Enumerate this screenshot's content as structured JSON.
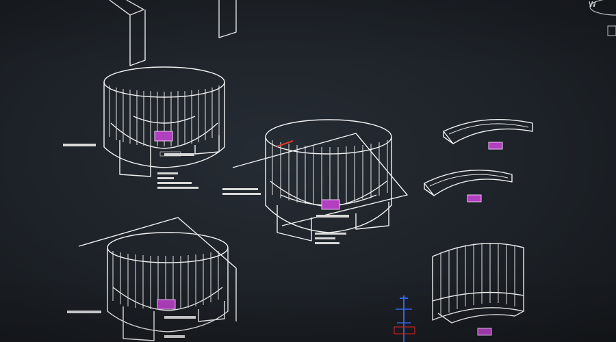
{
  "viewport": {
    "background": "#1d2228",
    "wire_color": "#f2f2f2",
    "marker_color": "#b23fc0",
    "axis_z_color": "#3b6cff",
    "axis_x_color": "#e02626"
  },
  "view_cube": {
    "compass_letter": "W"
  },
  "ucs_icon": {
    "name": "ucs-icon"
  },
  "annotations": {
    "note_1": "",
    "note_2": "",
    "note_3": "",
    "note_4": "",
    "note_5": "",
    "note_6": "",
    "note_7": "",
    "note_8": ""
  }
}
